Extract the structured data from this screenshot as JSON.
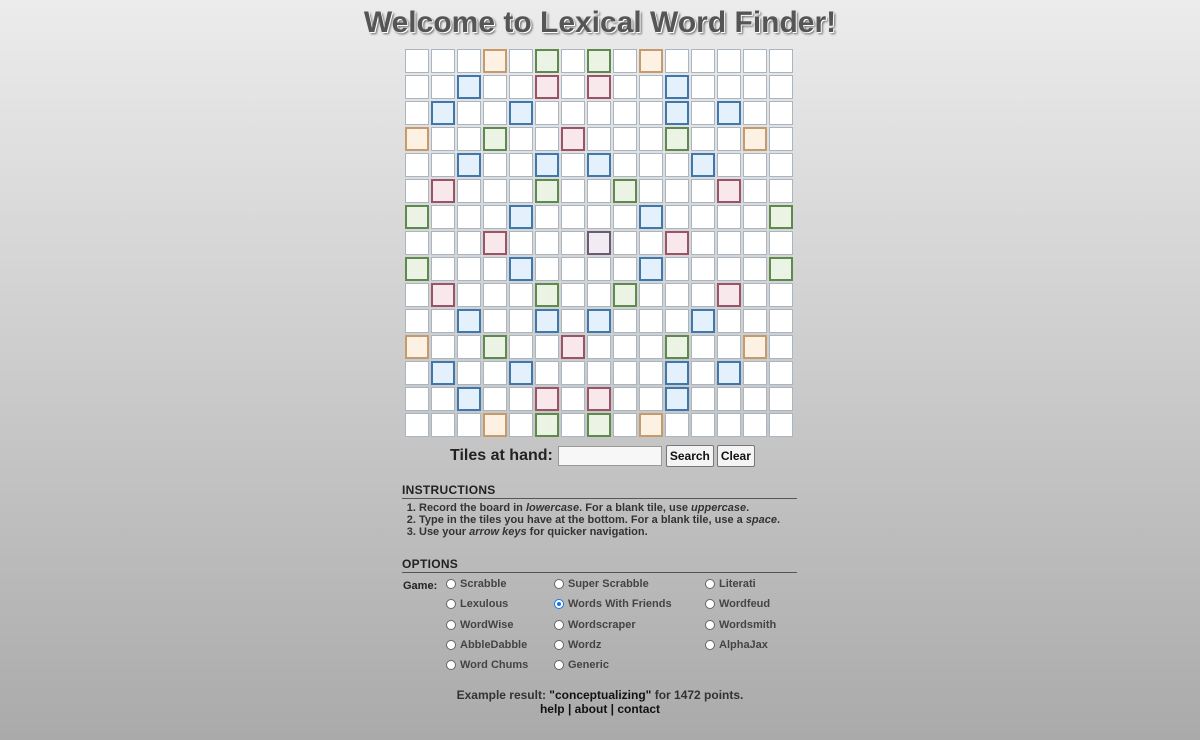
{
  "title": "Welcome to Lexical Word Finder!",
  "board": {
    "size": 15,
    "premium": [
      "...T.D.D.T.....",
      "..L..R.R..L....",
      ".L..L.....L.L..",
      "T..D..R...D..T.",
      "..L..L.L...L...",
      ".R...D..D...R..",
      "D...L....L....D",
      "...R...S..R....",
      "D...L....L....D",
      ".R...D..D...R..",
      "..L..L.L...L...",
      "T..D..R...D..T.",
      ".L..L.....L.L..",
      "..L..R.R..L....",
      "...T.D.D.T....."
    ],
    "legend": {
      "T": "triple-word",
      "D": "double-word",
      "L": "triple-letter",
      "R": "double-letter",
      "S": "center-star"
    }
  },
  "tiles": {
    "label": "Tiles at hand:",
    "value": "",
    "search_label": "Search",
    "clear_label": "Clear"
  },
  "instructions": {
    "heading": "INSTRUCTIONS",
    "items": [
      [
        {
          "t": "Record the board in "
        },
        {
          "t": "lowercase",
          "em": true
        },
        {
          "t": ". For a blank tile, use "
        },
        {
          "t": "uppercase",
          "em": true
        },
        {
          "t": "."
        }
      ],
      [
        {
          "t": "Type in the tiles you have at the bottom. For a blank tile, use a "
        },
        {
          "t": "space",
          "em": true
        },
        {
          "t": "."
        }
      ],
      [
        {
          "t": "Use your "
        },
        {
          "t": "arrow keys",
          "em": true
        },
        {
          "t": " for quicker navigation."
        }
      ]
    ]
  },
  "options": {
    "heading": "OPTIONS",
    "game_label": "Game:",
    "selected": "Words With Friends",
    "columns": [
      [
        "Scrabble",
        "Lexulous",
        "WordWise",
        "AbbleDabble",
        "Word Chums"
      ],
      [
        "Super Scrabble",
        "Words With Friends",
        "Wordscraper",
        "Wordz",
        "Generic"
      ],
      [
        "Literati",
        "Wordfeud",
        "Wordsmith",
        "AlphaJax"
      ]
    ]
  },
  "example": {
    "prefix": "Example result: ",
    "word": "\"conceptualizing\"",
    "suffix": " for 1472 points."
  },
  "footer": {
    "help": "help",
    "about": "about",
    "contact": "contact",
    "separator": "|"
  }
}
